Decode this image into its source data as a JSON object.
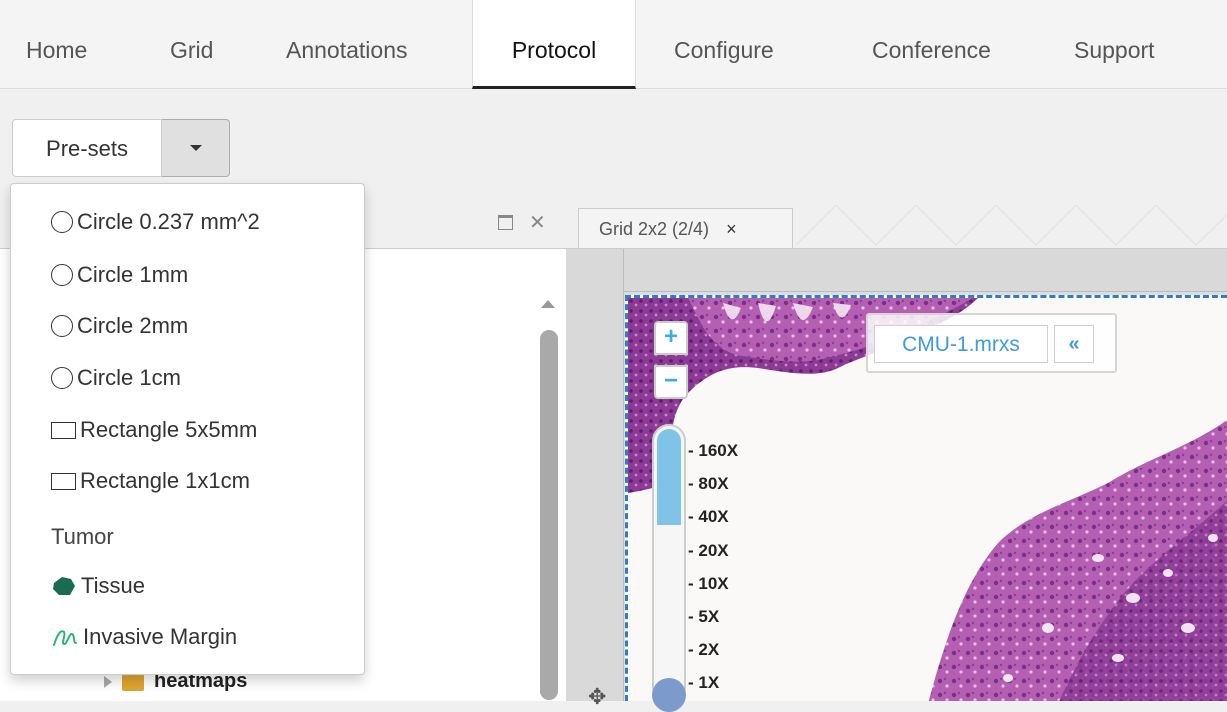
{
  "nav": {
    "tabs": [
      {
        "label": "Home"
      },
      {
        "label": "Grid"
      },
      {
        "label": "Annotations"
      },
      {
        "label": "Protocol"
      },
      {
        "label": "Configure"
      },
      {
        "label": "Conference"
      },
      {
        "label": "Support"
      }
    ],
    "active_tab": "Protocol"
  },
  "presets": {
    "label": "Pre-sets",
    "menu": {
      "items": [
        {
          "shape": "circle",
          "label": "Circle 0.237 mm^2"
        },
        {
          "shape": "circle",
          "label": "Circle 1mm"
        },
        {
          "shape": "circle",
          "label": "Circle 2mm"
        },
        {
          "shape": "circle",
          "label": "Circle 1cm"
        },
        {
          "shape": "rectangle",
          "label": "Rectangle 5x5mm"
        },
        {
          "shape": "rectangle",
          "label": "Rectangle 1x1cm"
        }
      ],
      "group_label": "Tumor",
      "group_items": [
        {
          "icon": "tissue-icon",
          "label": "Tissue"
        },
        {
          "icon": "invasive-margin-icon",
          "label": "Invasive Margin"
        }
      ]
    }
  },
  "tree": {
    "folder_label": "heatmaps"
  },
  "viewer": {
    "tab_label": "Grid 2x2 (2/4)",
    "tab_close": "×",
    "file_name": "CMU-1.mrxs",
    "collapse_label": "«",
    "zoom_in": "+",
    "zoom_out": "−",
    "zoom_levels": [
      "- 160X",
      "- 80X",
      "- 40X",
      "- 20X",
      "- 10X",
      "- 5X",
      "- 2X",
      "- 1X"
    ],
    "zoom_level_fraction": 0.35
  },
  "colors": {
    "accent_blue": "#2e7fc2",
    "tissue_green": "#1a6b50",
    "margin_green": "#2db37a",
    "stain_purple": "#9b3a9c"
  }
}
